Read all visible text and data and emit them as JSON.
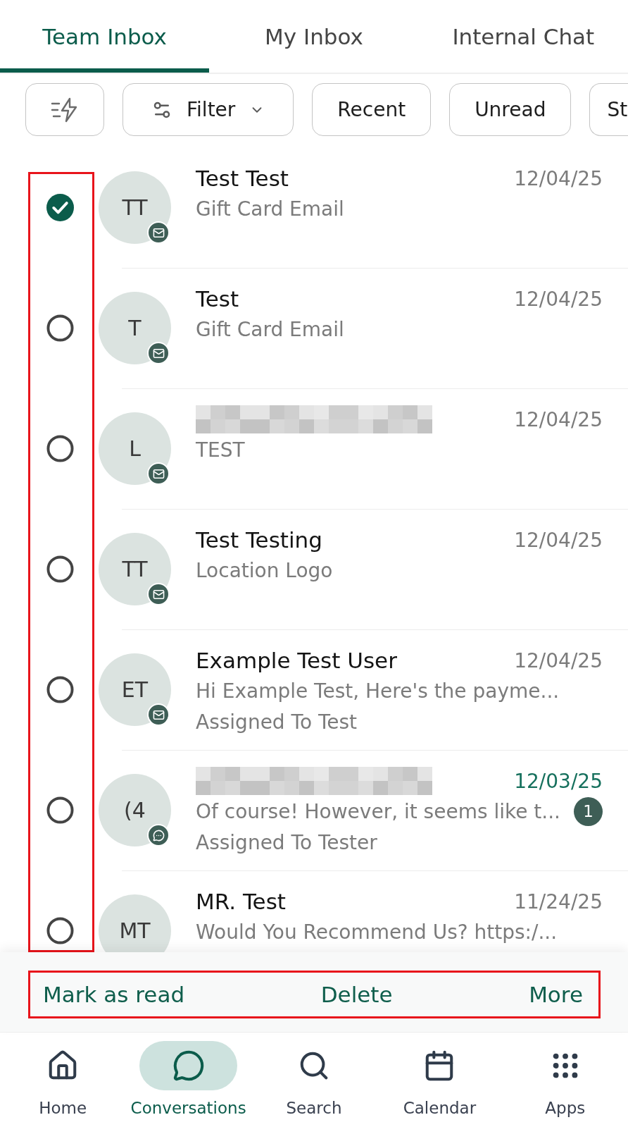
{
  "tabs": [
    {
      "label": "Team Inbox",
      "selected": true
    },
    {
      "label": "My Inbox",
      "selected": false
    },
    {
      "label": "Internal Chat",
      "selected": false
    }
  ],
  "filters": [
    {
      "kind": "icon"
    },
    {
      "kind": "dropdown",
      "label": "Filter"
    },
    {
      "kind": "chip",
      "label": "Recent"
    },
    {
      "kind": "chip",
      "label": "Unread"
    },
    {
      "kind": "chip",
      "label": "St"
    }
  ],
  "conversations": [
    {
      "checked": true,
      "initials": "TT",
      "channel_badge": {
        "kind": "email"
      },
      "name_redacted": false,
      "name": "Test Test",
      "date": "12/04/25",
      "unread": false,
      "preview": "Gift Card Email"
    },
    {
      "checked": false,
      "initials": "T",
      "channel_badge": {
        "kind": "email"
      },
      "name_redacted": false,
      "name": "Test",
      "date": "12/04/25",
      "unread": false,
      "preview": "Gift Card Email"
    },
    {
      "checked": false,
      "initials": "L",
      "channel_badge": {
        "kind": "email"
      },
      "name_redacted": true,
      "date": "12/04/25",
      "unread": false,
      "preview": "TEST"
    },
    {
      "checked": false,
      "initials": "TT",
      "channel_badge": {
        "kind": "email"
      },
      "name_redacted": false,
      "name": "Test Testing",
      "date": "12/04/25",
      "unread": false,
      "preview": "Location Logo"
    },
    {
      "checked": false,
      "initials": "ET",
      "channel_badge": {
        "kind": "email"
      },
      "name_redacted": false,
      "name": "Example Test User",
      "date": "12/04/25",
      "unread": false,
      "preview": "Hi Example Test, Here's the payme...",
      "assignee": "Assigned To Test"
    },
    {
      "checked": false,
      "initials": "(4",
      "channel_badge": {
        "kind": "chat"
      },
      "name_redacted": true,
      "date": "12/03/25",
      "unread": true,
      "unread_count": "1",
      "preview": "Of course! However, it seems like t...",
      "assignee": "Assigned To Tester"
    },
    {
      "checked": false,
      "initials": "MT",
      "name_redacted": false,
      "name": "MR. Test",
      "date": "11/24/25",
      "unread": false,
      "preview": "Would You Recommend Us? https:/..."
    }
  ],
  "bulk_actions": [
    {
      "label": "Mark as read"
    },
    {
      "label": "Delete"
    },
    {
      "label": "More"
    }
  ],
  "bottom_nav": [
    {
      "label": "Home",
      "selected": false
    },
    {
      "label": "Conversations",
      "selected": true
    },
    {
      "label": "Search",
      "selected": false
    },
    {
      "label": "Calendar",
      "selected": false
    },
    {
      "label": "Apps",
      "selected": false
    }
  ]
}
